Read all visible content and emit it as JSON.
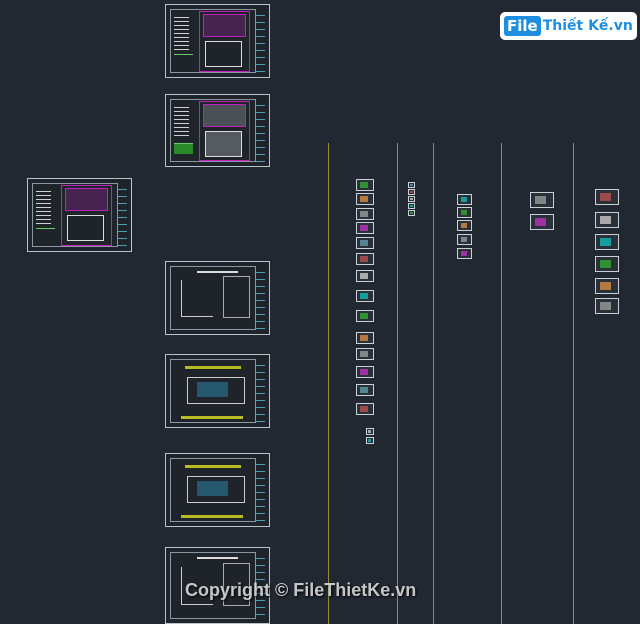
{
  "logo": {
    "part1": "File",
    "part2": "Thiết Kế.vn"
  },
  "watermark": "Copyright © FileThietKe.vn",
  "colors": {
    "background": "#222831",
    "guide_lines": "#8f8f3a",
    "sheet_border": "#b8c4cc",
    "accent_magenta": "#c020c0",
    "accent_yellow": "#e0e020"
  }
}
